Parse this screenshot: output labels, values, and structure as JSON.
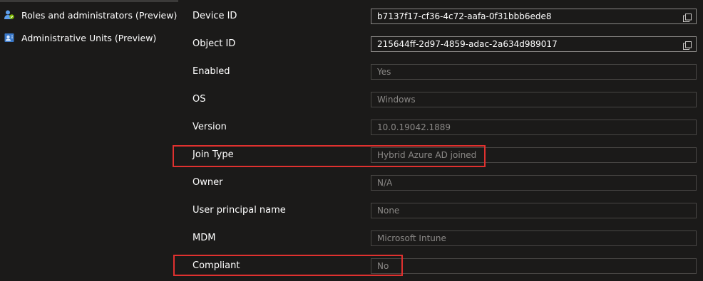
{
  "sidebar": {
    "items": [
      {
        "label": "Roles and administrators (Preview)",
        "icon": "roles-admin-icon"
      },
      {
        "label": "Administrative Units (Preview)",
        "icon": "admin-units-icon"
      }
    ]
  },
  "properties": {
    "device_id": {
      "label": "Device ID",
      "value": "b7137f17-cf36-4c72-aafa-0f31bbb6ede8"
    },
    "object_id": {
      "label": "Object ID",
      "value": "215644ff-2d97-4859-adac-2a634d989017"
    },
    "enabled": {
      "label": "Enabled",
      "value": "Yes"
    },
    "os": {
      "label": "OS",
      "value": "Windows"
    },
    "version": {
      "label": "Version",
      "value": "10.0.19042.1889"
    },
    "join_type": {
      "label": "Join Type",
      "value": "Hybrid Azure AD joined"
    },
    "owner": {
      "label": "Owner",
      "value": "N/A"
    },
    "upn": {
      "label": "User principal name",
      "value": "None"
    },
    "mdm": {
      "label": "MDM",
      "value": "Microsoft Intune"
    },
    "compliant": {
      "label": "Compliant",
      "value": "No"
    }
  },
  "colors": {
    "background": "#1b1a19",
    "highlight": "#e0312f",
    "field_border": "#484644",
    "disabled_text": "#8a8886"
  }
}
